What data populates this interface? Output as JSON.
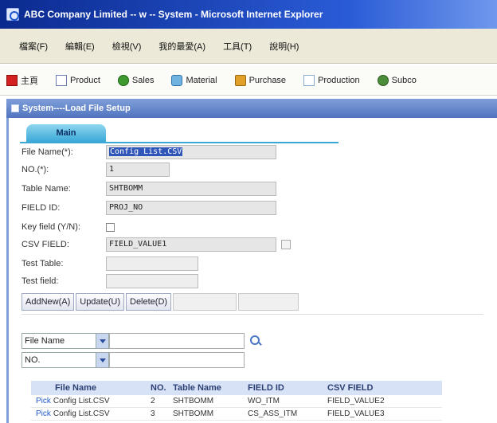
{
  "window": {
    "title": "ABC Company Limited -- w -- System - Microsoft Internet Explorer"
  },
  "menu": [
    "檔案(F)",
    "編輯(E)",
    "檢視(V)",
    "我的最愛(A)",
    "工具(T)",
    "說明(H)"
  ],
  "modules": [
    {
      "label": "主頁",
      "icon": "home-icon"
    },
    {
      "label": "Product",
      "icon": "document-icon"
    },
    {
      "label": "Sales",
      "icon": "sales-icon"
    },
    {
      "label": "Material",
      "icon": "material-icon"
    },
    {
      "label": "Purchase",
      "icon": "purchase-icon"
    },
    {
      "label": "Production",
      "icon": "production-icon"
    },
    {
      "label": "Subco",
      "icon": "subcon-icon"
    }
  ],
  "form": {
    "title": "System----Load File Setup",
    "tab": "Main",
    "fields": {
      "file_name": {
        "label": "File Name(*):",
        "value": "Config List.CSV"
      },
      "no": {
        "label": "NO.(*):",
        "value": "1"
      },
      "table_name": {
        "label": "Table Name:",
        "value": "SHTBOMM"
      },
      "field_id": {
        "label": "FIELD ID:",
        "value": "PROJ_NO"
      },
      "key_field": {
        "label": "Key field (Y/N):"
      },
      "csv_field": {
        "label": "CSV FIELD:",
        "value": "FIELD_VALUE1"
      },
      "test_table": {
        "label": "Test Table:",
        "value": ""
      },
      "test_field": {
        "label": "Test field:",
        "value": ""
      }
    },
    "buttons": {
      "add_new": "AddNew(A)",
      "update": "Update(U)",
      "delete": "Delete(D)"
    }
  },
  "search": {
    "filters": [
      {
        "selected": "File Name",
        "value": ""
      },
      {
        "selected": "NO.",
        "value": ""
      }
    ]
  },
  "table": {
    "columns": [
      "File Name",
      "NO.",
      "Table Name",
      "FIELD ID",
      "CSV FIELD"
    ],
    "pick_label": "Pick",
    "rows": [
      {
        "file_name": "Config List.CSV",
        "no": "2",
        "table_name": "SHTBOMM",
        "field_id": "WO_ITM",
        "csv_field": "FIELD_VALUE2"
      },
      {
        "file_name": "Config List.CSV",
        "no": "3",
        "table_name": "SHTBOMM",
        "field_id": "CS_ASS_ITM",
        "csv_field": "FIELD_VALUE3"
      }
    ]
  }
}
